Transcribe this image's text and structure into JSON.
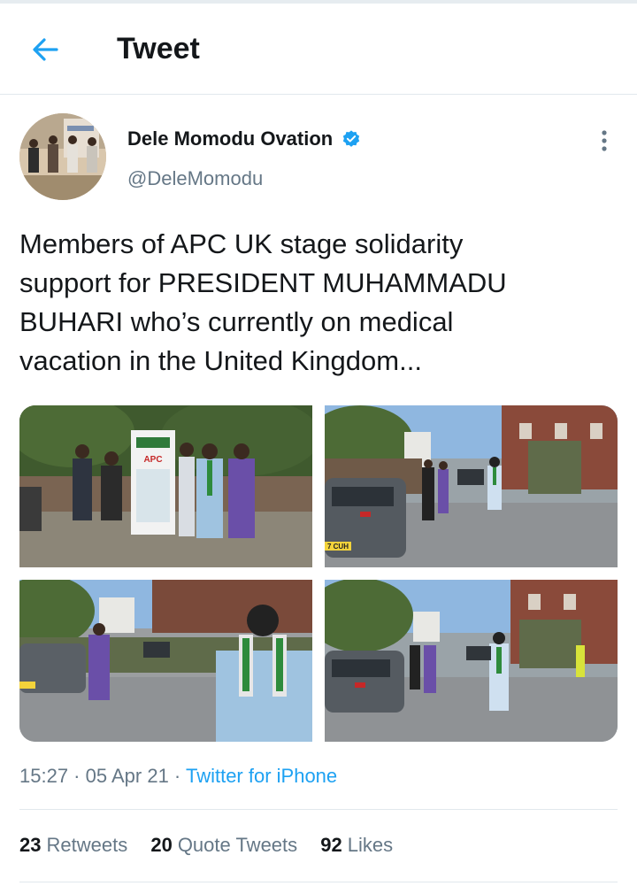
{
  "header": {
    "title": "Tweet",
    "back_icon": "arrow-left-icon",
    "accent_color": "#1da1f2"
  },
  "author": {
    "name": "Dele Momodu Ovation",
    "handle": "@DeleMomodu",
    "verified": true,
    "verified_icon": "verified-badge-icon"
  },
  "tweet": {
    "text": "Members of APC UK stage solidarity\nsupport for PRESIDENT MUHAMMADU\nBUHARI who’s currently on medical\nvacation in the United Kingdom...",
    "media_count": 4,
    "media": [
      {
        "icon": "photo-group-with-apc-banner"
      },
      {
        "icon": "photo-street-walk"
      },
      {
        "icon": "photo-street-walk"
      },
      {
        "icon": "photo-street-walk"
      }
    ],
    "banner_text": "APC",
    "plate_text": "7 CUH"
  },
  "meta": {
    "time": "15:27",
    "sep": " · ",
    "date": "05 Apr 21",
    "source": "Twitter for iPhone"
  },
  "stats": {
    "retweets_count": "23",
    "retweets_label": "Retweets",
    "quotes_count": "20",
    "quotes_label": "Quote Tweets",
    "likes_count": "92",
    "likes_label": "Likes"
  }
}
